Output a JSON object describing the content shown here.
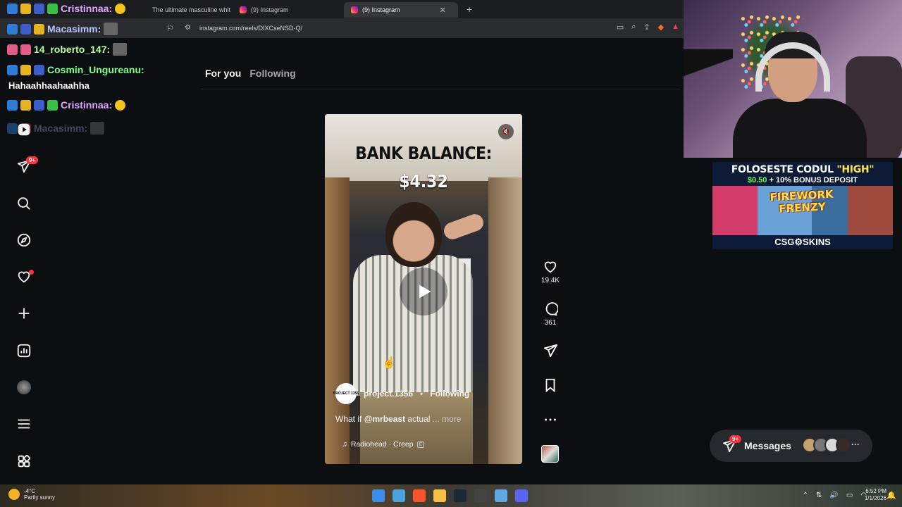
{
  "browser": {
    "tabs": [
      {
        "label": "The ultimate masculine whit"
      },
      {
        "label": "(9) Instagram"
      },
      {
        "label": "(9) Instagram",
        "active": true
      }
    ],
    "url": "instagram.com/reels/DIXCseNSD-Q/"
  },
  "chat": [
    {
      "user": "Cristinnaa:",
      "color": "#e0a6ff",
      "message": ""
    },
    {
      "user": "Macasimm:",
      "color": "#b8c6ff",
      "message": ""
    },
    {
      "user": "14_roberto_147:",
      "color": "#b7ff9c",
      "message": ""
    },
    {
      "user": "Cosmin_Ungureanu:",
      "color": "#7dff88",
      "message": "Hahaahhaahaahha"
    },
    {
      "user": "Cristinnaa:",
      "color": "#e0a6ff",
      "message": ""
    },
    {
      "user": "Macasimm:",
      "color": "#8090b8",
      "message": ""
    }
  ],
  "sidebar": {
    "reels_badge": "9+",
    "icons": [
      "play-icon",
      "share-icon",
      "search-icon",
      "explore-icon",
      "heart-icon",
      "create-icon",
      "insights-icon",
      "profile-icon",
      "menu-icon",
      "apps-icon"
    ]
  },
  "feed": {
    "tabs": [
      {
        "label": "For you",
        "active": true
      },
      {
        "label": "Following"
      }
    ]
  },
  "reel": {
    "overlay_title": "BANK BALANCE:",
    "overlay_amount": "$4.32",
    "author": "project.1356",
    "author_pfp_text": "PROJECT 1356",
    "follow_state": "Following",
    "caption_start": "What if ",
    "caption_mention": "@mrbeast",
    "caption_rest": " actual",
    "caption_more": "... more",
    "audio": "Radiohead · Creep",
    "explicit": "E"
  },
  "actions": {
    "likes": "19.4K",
    "comments": "361"
  },
  "promo": {
    "code_prefix": "FOLOSESTE CODUL ",
    "code": "\"HIGH\"",
    "bonus_amount": "$0.50",
    "bonus_rest": " + 10% BONUS DEPOSIT",
    "game": "FIREWORK FRENZY",
    "brand": "CSG⚙SKINS"
  },
  "messages": {
    "label": "Messages",
    "badge": "9+",
    "more": "···"
  },
  "taskbar": {
    "temp": "-4°C",
    "weather": "Partly sunny",
    "time": "6:52 PM",
    "date": "1/1/2026"
  }
}
